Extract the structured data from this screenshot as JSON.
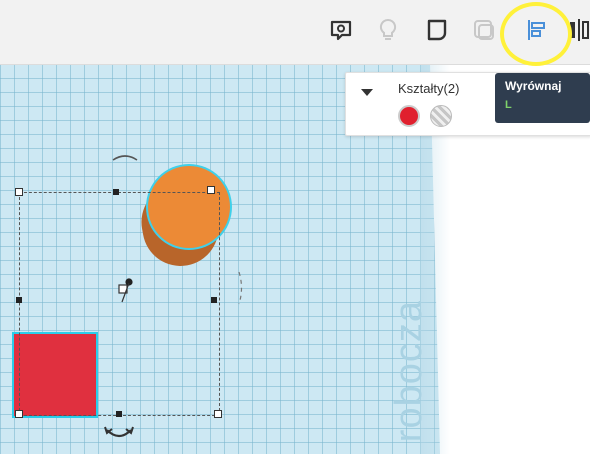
{
  "toolbar": {
    "buttons": [
      {
        "name": "notes-icon"
      },
      {
        "name": "lightbulb-icon"
      },
      {
        "name": "shape-icon"
      },
      {
        "name": "hole-icon"
      },
      {
        "name": "align-icon"
      },
      {
        "name": "mirror-icon"
      }
    ]
  },
  "workplane": {
    "label": "robocza"
  },
  "shapes_panel": {
    "title": "Kształty(2)",
    "swatches": [
      {
        "type": "solid",
        "color": "#e0202e"
      },
      {
        "type": "hole"
      }
    ]
  },
  "tooltip": {
    "title": "Wyrównaj",
    "shortcut": "L"
  },
  "colors": {
    "accent": "#2bcde9",
    "highlight": "#fff13a",
    "cylinder": "#ec8a36",
    "box": "#e0303f",
    "workplane": "#cde8f3"
  }
}
